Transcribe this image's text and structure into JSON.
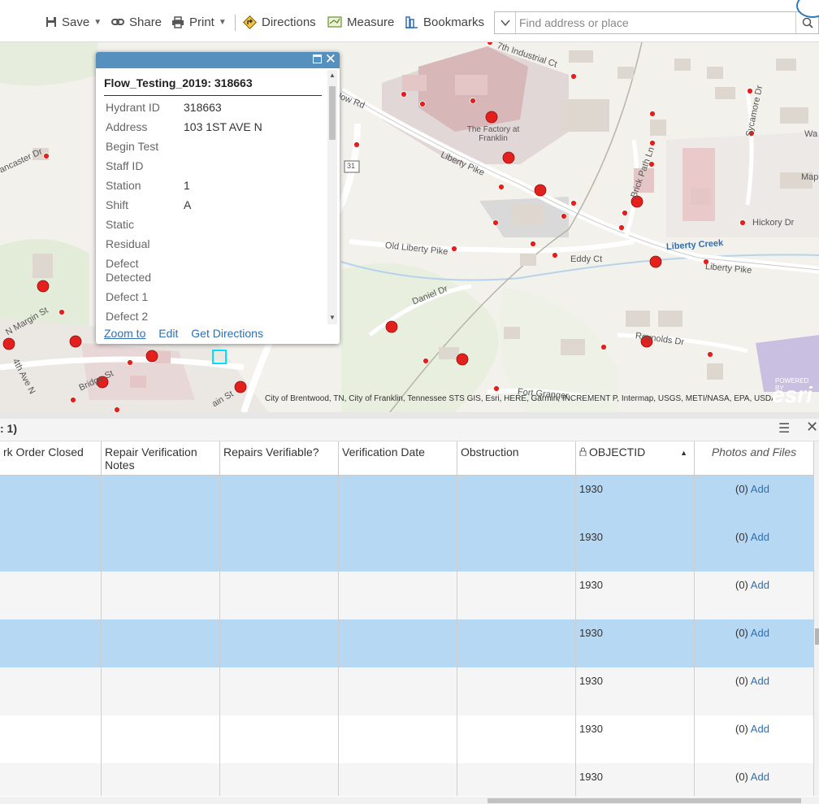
{
  "toolbar": {
    "save_label": "Save",
    "share_label": "Share",
    "print_label": "Print",
    "directions_label": "Directions",
    "measure_label": "Measure",
    "bookmarks_label": "Bookmarks",
    "search_placeholder": "Find address or place"
  },
  "map": {
    "labels": {
      "industrial_ct": "7th Industrial Ct",
      "meadow_rd": "slow Rd",
      "lancaster_dr": "ancaster Dr",
      "liberty_pike_1": "Liberty Pike",
      "liberty_pike_2": "Liberty Pike",
      "old_liberty_pike": "Old Liberty Pike",
      "eddy_ct": "Eddy Ct",
      "daniel_dr": "Daniel Dr",
      "reynolds_dr": "Reynolds Dr",
      "hickory_dr": "Hickory Dr",
      "liberty_creek": "Liberty Creek",
      "brick_path_ln": "Brick Path Ln",
      "sycamore_dr": "Sycamore Dr",
      "margin_st": "N Margin St",
      "fourth_ave": "4th Ave N",
      "bridge_st": "Bridge St",
      "main_st": "ain St",
      "fort_granger": "Fort Granger",
      "route_31": "31",
      "wa": "Wa",
      "map_label": "Map",
      "factory": "The Factory at Franklin"
    },
    "attribution": "City of Brentwood, TN, City of Franklin, Tennessee STS GIS, Esri, HERE, Garmin, INCREMENT P, Intermap, USGS, METI/NASA, EPA, USDA",
    "esri_powered": "POWERED BY",
    "esri_logo": "esri"
  },
  "popup": {
    "title": "Flow_Testing_2019: 318663",
    "fields": [
      {
        "key": "Hydrant ID",
        "value": "318663"
      },
      {
        "key": "Address",
        "value": "103 1ST AVE N"
      },
      {
        "key": "Begin Test",
        "value": ""
      },
      {
        "key": "Staff ID",
        "value": ""
      },
      {
        "key": "Station",
        "value": "1"
      },
      {
        "key": "Shift",
        "value": "A"
      },
      {
        "key": "Static",
        "value": ""
      },
      {
        "key": "Residual",
        "value": ""
      },
      {
        "key": "Defect Detected",
        "value": ""
      },
      {
        "key": "Defect 1",
        "value": ""
      },
      {
        "key": "Defect 2",
        "value": ""
      }
    ],
    "actions": {
      "zoom_to": "Zoom to",
      "edit": "Edit",
      "get_directions": "Get Directions"
    }
  },
  "table": {
    "title": ": 1)",
    "columns": [
      {
        "label": "rk Order Closed"
      },
      {
        "label": "Repair Verification Notes"
      },
      {
        "label": "Repairs Verifiable?"
      },
      {
        "label": "Verification Date"
      },
      {
        "label": "Obstruction"
      },
      {
        "label": "OBJECTID"
      },
      {
        "label": "Photos and Files"
      }
    ],
    "rows": [
      {
        "objectid": "1930",
        "photos_count": "(0)",
        "photos_add": "Add",
        "state": "sel"
      },
      {
        "objectid": "1930",
        "photos_count": "(0)",
        "photos_add": "Add",
        "state": "sel"
      },
      {
        "objectid": "1930",
        "photos_count": "(0)",
        "photos_add": "Add",
        "state": "alt"
      },
      {
        "objectid": "1930",
        "photos_count": "(0)",
        "photos_add": "Add",
        "state": "sel"
      },
      {
        "objectid": "1930",
        "photos_count": "(0)",
        "photos_add": "Add",
        "state": "alt"
      },
      {
        "objectid": "1930",
        "photos_count": "(0)",
        "photos_add": "Add",
        "state": "plain"
      },
      {
        "objectid": "1930",
        "photos_count": "(0)",
        "photos_add": "Add",
        "state": "alt"
      }
    ]
  },
  "colors": {
    "popup_header": "#5590be",
    "selected_row": "#b7d8f2",
    "hydrant_marker": "#e3201b",
    "link": "#2e6fb4"
  }
}
